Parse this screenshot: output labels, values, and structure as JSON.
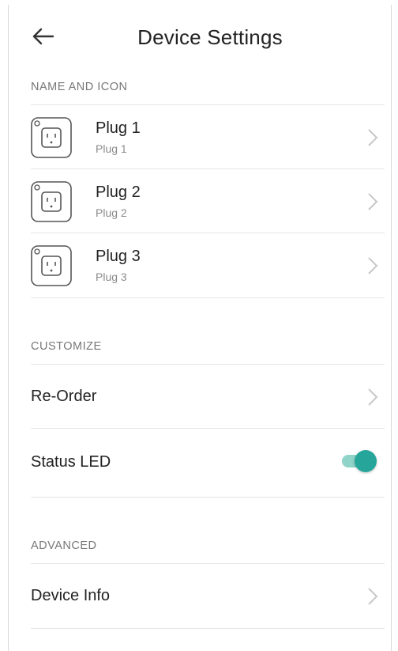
{
  "header": {
    "title": "Device Settings",
    "back_icon": "arrow-left-icon"
  },
  "sections": {
    "name_and_icon": {
      "label": "NAME AND ICON",
      "plugs": [
        {
          "name": "Plug 1",
          "subtitle": "Plug 1",
          "icon": "outlet-icon"
        },
        {
          "name": "Plug 2",
          "subtitle": "Plug 2",
          "icon": "outlet-icon"
        },
        {
          "name": "Plug 3",
          "subtitle": "Plug 3",
          "icon": "outlet-icon"
        }
      ]
    },
    "customize": {
      "label": "CUSTOMIZE",
      "reorder_label": "Re-Order",
      "status_led_label": "Status LED",
      "status_led_on": true
    },
    "advanced": {
      "label": "ADVANCED",
      "device_info_label": "Device Info"
    }
  },
  "colors": {
    "accent": "#26a69a",
    "toggle_track": "#8fd3c9",
    "chevron": "#c8c8c8",
    "divider": "#e6e6e6"
  }
}
